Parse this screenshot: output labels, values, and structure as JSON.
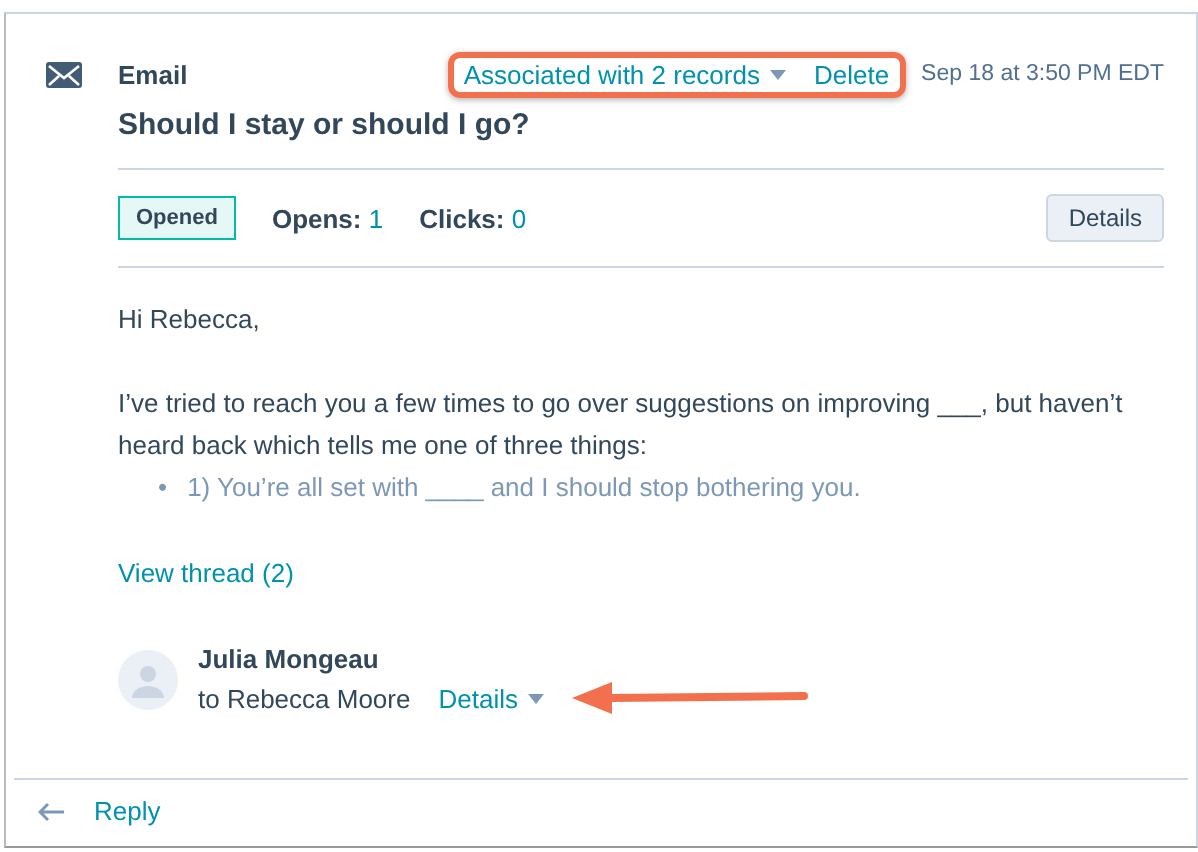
{
  "header": {
    "type_label": "Email",
    "associations_link": "Associated with 2 records",
    "delete_link": "Delete",
    "timestamp": "Sep 18 at 3:50 PM EDT",
    "subject": "Should I stay or should I go?"
  },
  "stats": {
    "status_badge": "Opened",
    "metrics": [
      {
        "label": "Opens:",
        "value": "1"
      },
      {
        "label": "Clicks:",
        "value": "0"
      }
    ],
    "details_button": "Details"
  },
  "body": {
    "greeting": "Hi Rebecca,",
    "paragraph": "I’ve tried to reach you a few times to go over suggestions on improving ___, but haven’t heard back which tells me one of three things:",
    "bullets": [
      {
        "marker": "•",
        "text": "1) You’re all set with ____ and I should stop bothering you."
      }
    ]
  },
  "view_thread": "View thread (2)",
  "sender": {
    "name": "Julia Mongeau",
    "recipient": "to Rebecca Moore",
    "details_link": "Details"
  },
  "footer": {
    "reply": "Reply"
  }
}
